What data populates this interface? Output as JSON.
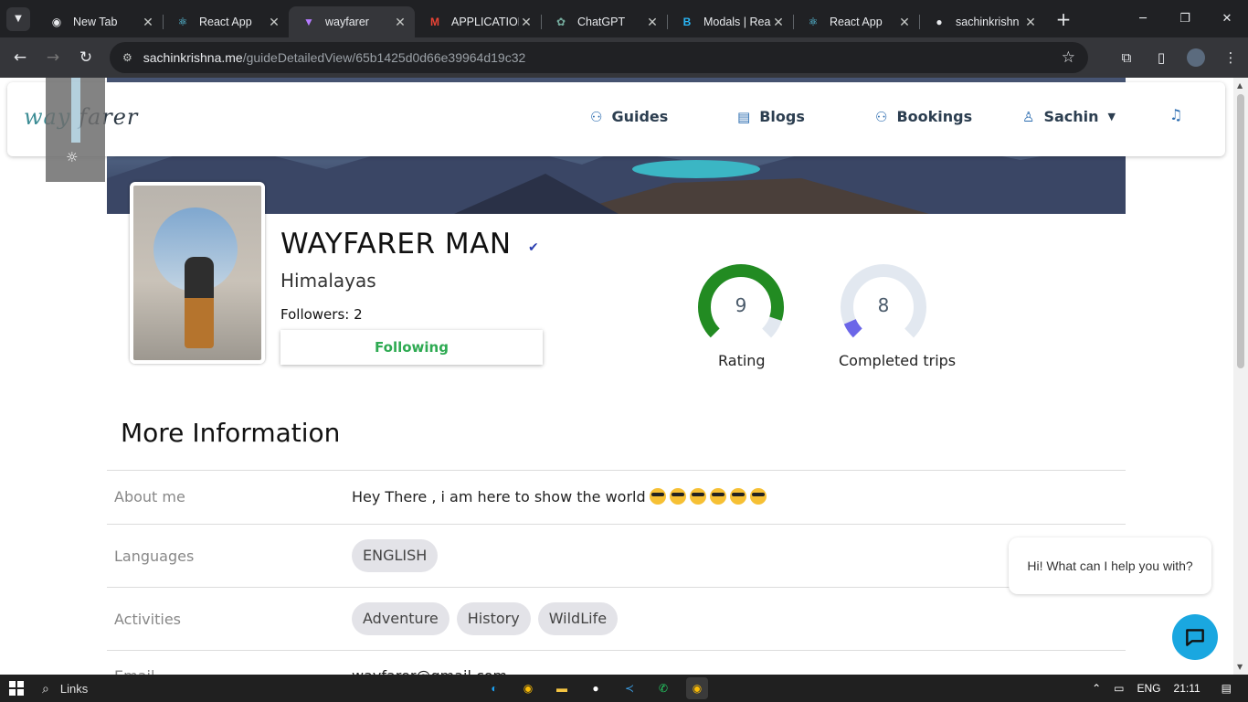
{
  "browser": {
    "tabs": [
      {
        "title": "New Tab",
        "icon": "chrome-icon"
      },
      {
        "title": "React App",
        "icon": "react-icon"
      },
      {
        "title": "wayfarer",
        "icon": "vite-icon",
        "active": true
      },
      {
        "title": "APPLICATION",
        "icon": "gmail-icon"
      },
      {
        "title": "ChatGPT",
        "icon": "chatgpt-icon"
      },
      {
        "title": "Modals | Rea",
        "icon": "bootstrap-icon"
      },
      {
        "title": "React App",
        "icon": "react-icon"
      },
      {
        "title": "sachinkrishn",
        "icon": "github-icon"
      }
    ],
    "url_host": "sachinkrishna.me",
    "url_path": "/guideDetailedView/65b1425d0d66e39964d19c32"
  },
  "nav": {
    "logo_prefix": "way",
    "logo_suffix": "farer",
    "links": {
      "guides": "Guides",
      "blogs": "Blogs",
      "bookings": "Bookings",
      "user": "Sachin"
    }
  },
  "profile": {
    "name": "WAYFARER MAN",
    "region": "Himalayas",
    "followers": "Followers: 2",
    "follow_button": "Following",
    "rating": {
      "value": "9",
      "label": "Rating",
      "fraction": 0.9
    },
    "trips": {
      "value": "8",
      "label": "Completed trips",
      "fraction": 0.08
    },
    "colors": {
      "rating": "#228b22",
      "trips": "#6b66e8",
      "track": "#e2e8f0",
      "following": "#2eaa52"
    }
  },
  "more_info": {
    "title": "More Information",
    "about_label": "About me",
    "about_value": "Hey There , i am here to show the world",
    "languages_label": "Languages",
    "languages": [
      "ENGLISH"
    ],
    "activities_label": "Activities",
    "activities": [
      "Adventure",
      "History",
      "WildLife"
    ],
    "email_label": "Email",
    "email_value": "wayfarer@gmail.com"
  },
  "chat": {
    "bubble": "Hi! What can I help you with?"
  },
  "taskbar": {
    "search_label": "Links",
    "lang": "ENG",
    "time": "21:11"
  }
}
